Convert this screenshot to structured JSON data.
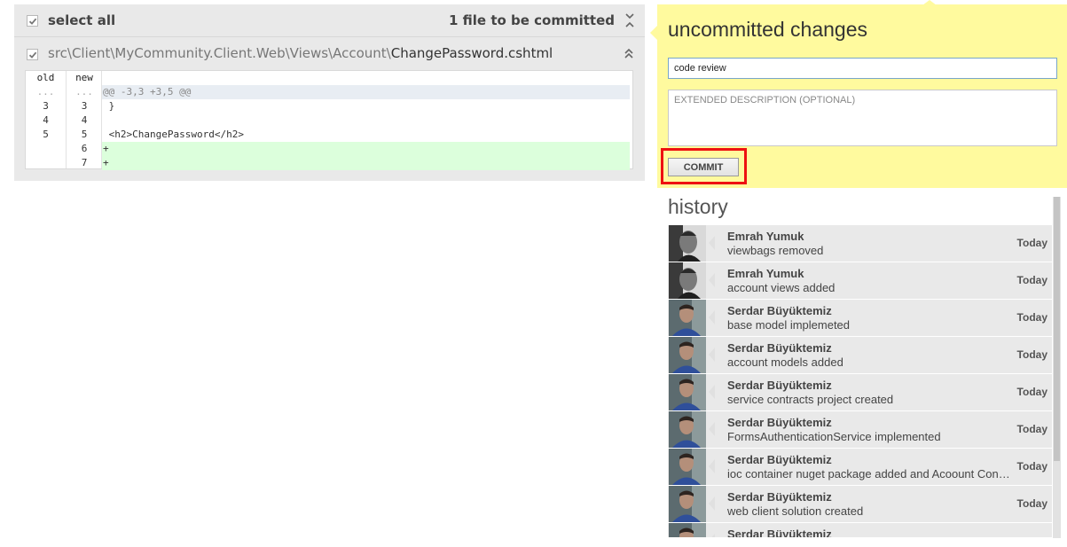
{
  "changes": {
    "select_all_label": "select all",
    "files_count_label": "1 file to be committed",
    "file": {
      "path_prefix": "src\\Client\\MyCommunity.Client.Web\\Views\\Account\\",
      "filename": "ChangePassword.cshtml",
      "checked": true
    },
    "diff": {
      "col_old": "old",
      "col_new": "new",
      "rows": [
        {
          "kind": "hunk",
          "old": "...",
          "new": "...",
          "code": "@@ -3,3 +3,5 @@"
        },
        {
          "kind": "context",
          "old": "3",
          "new": "3",
          "code": " }"
        },
        {
          "kind": "context",
          "old": "4",
          "new": "4",
          "code": ""
        },
        {
          "kind": "context",
          "old": "5",
          "new": "5",
          "code": " <h2>ChangePassword</h2>"
        },
        {
          "kind": "added",
          "old": "",
          "new": "6",
          "code": "+"
        },
        {
          "kind": "added",
          "old": "",
          "new": "7",
          "code": "+"
        }
      ]
    }
  },
  "commit": {
    "title": "uncommitted changes",
    "summary_value": "code review",
    "description_placeholder": "EXTENDED DESCRIPTION (OPTIONAL)",
    "commit_label": "COMMIT",
    "panel_color": "#fffa9e",
    "highlight_color": "#ee1111"
  },
  "history": {
    "title": "history",
    "items": [
      {
        "author": "Emrah Yumuk",
        "message": "viewbags removed",
        "date": "Today",
        "avatar": "emrah"
      },
      {
        "author": "Emrah Yumuk",
        "message": "account views added",
        "date": "Today",
        "avatar": "emrah"
      },
      {
        "author": "Serdar Büyüktemiz",
        "message": "base model implemeted",
        "date": "Today",
        "avatar": "serdar"
      },
      {
        "author": "Serdar Büyüktemiz",
        "message": "account models added",
        "date": "Today",
        "avatar": "serdar"
      },
      {
        "author": "Serdar Büyüktemiz",
        "message": "service contracts project created",
        "date": "Today",
        "avatar": "serdar"
      },
      {
        "author": "Serdar Büyüktemiz",
        "message": "FormsAuthenticationService implemented",
        "date": "Today",
        "avatar": "serdar"
      },
      {
        "author": "Serdar Büyüktemiz",
        "message": "ioc container nuget package added and Acoount Controller refactored",
        "date": "Today",
        "avatar": "serdar"
      },
      {
        "author": "Serdar Büyüktemiz",
        "message": "web client solution created",
        "date": "Today",
        "avatar": "serdar"
      },
      {
        "author": "Serdar Büyüktemiz",
        "message": "",
        "date": "",
        "avatar": "serdar"
      }
    ]
  }
}
